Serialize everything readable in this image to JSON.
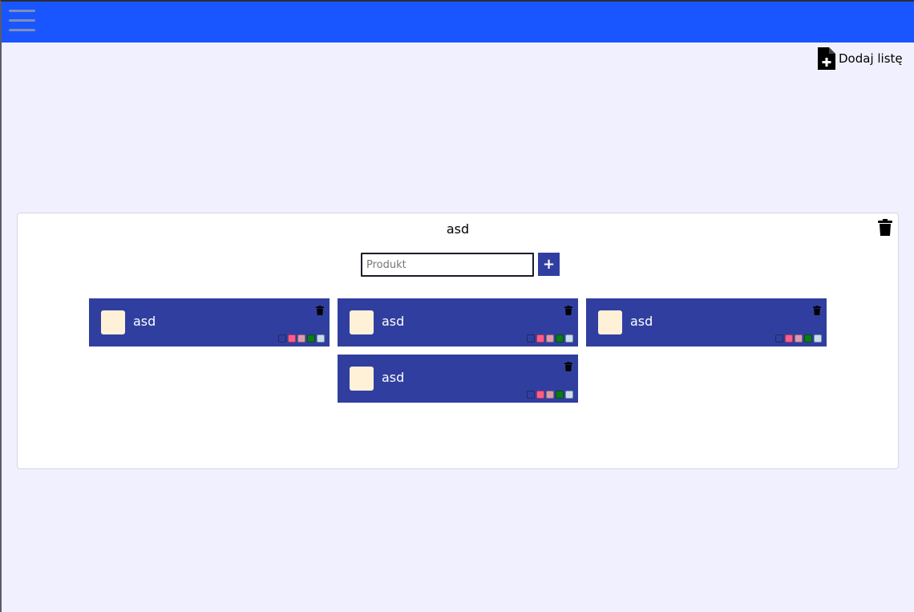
{
  "header": {
    "menu_icon": "hamburger-menu-icon"
  },
  "toolbar": {
    "add_list_label": "Dodaj listę",
    "add_list_icon": "file-plus-icon"
  },
  "list": {
    "title": "asd",
    "delete_icon": "trash-icon",
    "input": {
      "placeholder": "Produkt",
      "value": ""
    },
    "add_button_label": "+",
    "items": [
      {
        "label": "asd"
      },
      {
        "label": "asd"
      },
      {
        "label": "asd"
      },
      {
        "label": "asd"
      }
    ],
    "swatch_colors": [
      "#303f9f",
      "#ff5c8a",
      "#d99ab0",
      "#0a7a1a",
      "#c8dcf0"
    ]
  },
  "colors": {
    "topbar": "#1a56ff",
    "item_background": "#303f9f",
    "page_background": "#f0f0ff",
    "item_box": "#fff0d8"
  }
}
